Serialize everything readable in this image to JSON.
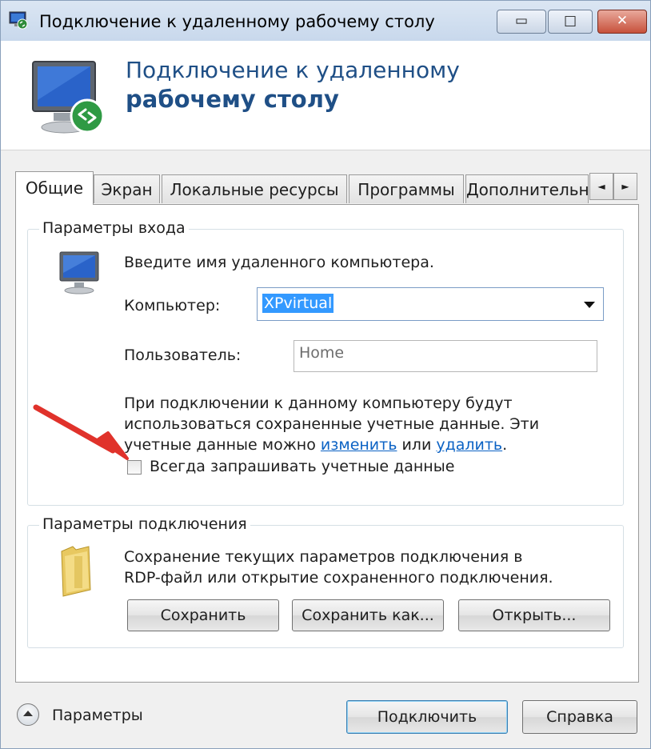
{
  "window": {
    "title": "Подключение к удаленному рабочему столу",
    "controls": {
      "minimize_glyph": "▭",
      "maximize_glyph": "□",
      "close_glyph": "✕"
    }
  },
  "header": {
    "line1": "Подключение к удаленному",
    "line2": "рабочему столу"
  },
  "tabs": [
    {
      "label": "Общие",
      "active": true
    },
    {
      "label": "Экран"
    },
    {
      "label": "Локальные ресурсы"
    },
    {
      "label": "Программы"
    },
    {
      "label": "Дополнительн"
    }
  ],
  "tab_scroll": {
    "left": "◄",
    "right": "►"
  },
  "login_group": {
    "title": "Параметры входа",
    "prompt": "Введите имя удаленного компьютера.",
    "computer_label": "Компьютер:",
    "computer_value": "XPvirtual",
    "user_label": "Пользователь:",
    "user_value": "Home",
    "info_line1": "При подключении к данному компьютеру будут",
    "info_line2": "использоваться сохраненные учетные данные.  Эти",
    "info_line3_prefix": "учетные данные можно ",
    "link_change": "изменить",
    "info_line3_mid": " или ",
    "link_delete": "удалить",
    "info_line3_suffix": ".",
    "always_ask_label": "Всегда запрашивать учетные данные",
    "always_ask_checked": false
  },
  "connection_group": {
    "title": "Параметры подключения",
    "desc_line1": "Сохранение текущих параметров подключения в",
    "desc_line2": "RDP-файл или открытие сохраненного подключения.",
    "save_label": "Сохранить",
    "save_as_label": "Сохранить как...",
    "open_label": "Открыть..."
  },
  "footer": {
    "params_label": "Параметры",
    "connect_label": "Подключить",
    "help_label": "Справка"
  },
  "colors": {
    "annotation_arrow": "#e0322b",
    "header_text": "#1f4f86",
    "link": "#0b62c4",
    "selection": "#3399ff"
  }
}
